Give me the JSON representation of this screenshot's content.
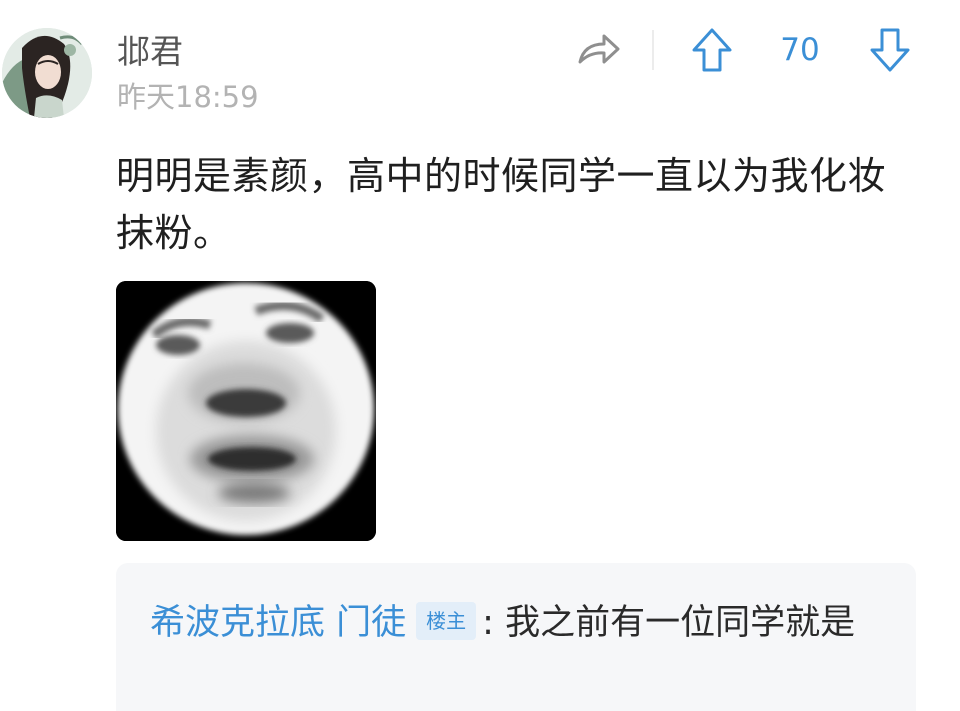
{
  "post": {
    "username": "邶君",
    "timestamp": "昨天18:59",
    "avatar_icon": "avatar-icon",
    "vote_count": "70",
    "share_icon": "share-icon",
    "upvote_icon": "upvote-arrow-icon",
    "downvote_icon": "downvote-arrow-icon",
    "text": "明明是素颜，高中的时候同学一直以为我化妆抹粉。",
    "meme_icon": "blurry-face-meme-icon"
  },
  "reply": {
    "author": "希波克拉底 门徒",
    "badge": "楼主",
    "separator": ":",
    "text": "我之前有一位同学就是"
  },
  "colors": {
    "accent": "#3b8fd6",
    "username": "#555555",
    "timestamp": "#b3b3b3",
    "reply_bg": "#f6f7f9",
    "badge_bg": "#e3eef9"
  }
}
